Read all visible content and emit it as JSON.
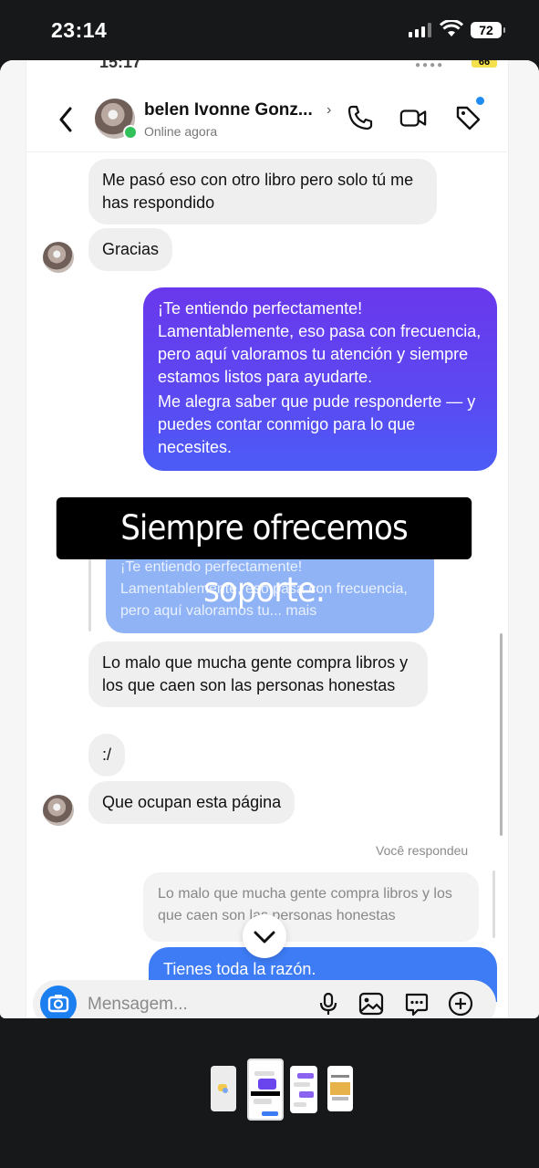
{
  "status_bar": {
    "time": "23:14",
    "battery": "72"
  },
  "screenshot": {
    "ghost_status": {
      "time": "15:17",
      "battery": "66"
    },
    "header": {
      "contact_name": "belen Ivonne Gonz...",
      "status": "Online agora"
    },
    "messages": {
      "recv_1": "Me pasó eso con otro libro pero solo tú me has respondido",
      "recv_2": "Gracias",
      "sent_1": {
        "p1": "¡Te entiendo perfectamente! Lamentablemente, eso pasa con frecuencia, pero aquí valoramos tu atención y siempre estamos listos para ayudarte.",
        "p2": "Me alegra saber que pude responderte — y puedes contar conmigo para lo que necesites."
      },
      "quote_line1": "¡Te entiendo perfectamente!",
      "quote_line2": "Lamentablemente, eso pasa con frecuencia, pero aquí valoramos tu... mais",
      "recv_3": "Lo malo que mucha gente compra libros y los que caen son las personas honestas",
      "recv_4": ":/",
      "recv_5": "Que ocupan esta página",
      "reply_label": "Você respondeu",
      "reply_quote": "Lo malo que mucha gente compra libros y los que caen son las personas honestas",
      "sent_2": "Tienes toda la razón."
    },
    "composer_placeholder": "Mensagem..."
  },
  "overlay_caption": "Siempre ofrecemos soporte.",
  "colors": {
    "accent": "#5b49f2",
    "blue": "#3d7cf5",
    "online": "#31c05a"
  },
  "icons": [
    "back-icon",
    "phone-icon",
    "video-icon",
    "tag-icon",
    "camera-icon",
    "mic-icon",
    "image-icon",
    "sticker-icon",
    "plus-icon",
    "chevron-down-icon"
  ]
}
